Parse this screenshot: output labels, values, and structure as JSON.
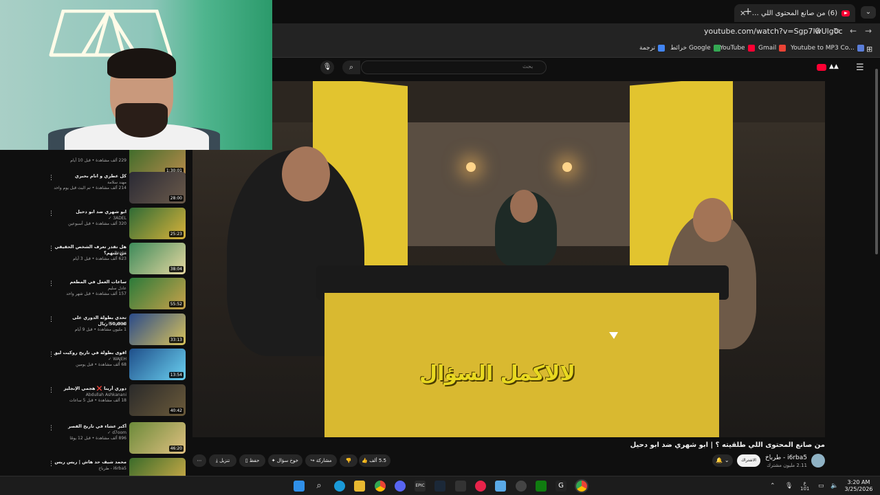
{
  "browser": {
    "tab_title": "(6) من صانع المحتوى اللي ط...",
    "tab_close": "✕",
    "new_tab": "+",
    "url": "youtube.com/watch?v=Sgp7lwUlg0c",
    "bookmarks": [
      {
        "label": "Youtube to MP3 Co...",
        "color": "#5a7dd8"
      },
      {
        "label": "Gmail",
        "color": "#ea4335"
      },
      {
        "label": "YouTube",
        "color": "#ff0033"
      },
      {
        "label": "خرائط Google",
        "color": "#34a853"
      },
      {
        "label": "ترجمة",
        "color": "#4285f4"
      }
    ]
  },
  "youtube": {
    "search_placeholder": "بحث",
    "video": {
      "caption": "لالاكمل السؤال",
      "title": "من صانع المحتوى اللي طلقيته ؟ | ابو شهري ضد ابو دحيل",
      "channel": "i6rba5 - طرباخ",
      "subscribers": "2.11 مليون مشترك",
      "subscribe_label": "الاشتراك",
      "likes": "5.5 ألف",
      "share_label": "مشاركة",
      "ask_label": "خوخ سؤال",
      "save_label": "حفظ",
      "download_label": "تنزيل",
      "more_label": "⋯"
    },
    "recommendations": [
      {
        "title": "",
        "channel": "",
        "meta": "229 ألف مشاهدة • قبل 10 أيام",
        "duration": "1:30:01",
        "colors": [
          "#3a6b2a",
          "#b58a4a"
        ]
      },
      {
        "title": "كل عطري و انام بحبري",
        "channel": "مهند سلامة",
        "meta": "214 ألف مشاهدة • تم البث قبل يوم واحد",
        "duration": "28:00",
        "colors": [
          "#2a2a35",
          "#6b5a4a"
        ]
      },
      {
        "title": "ابو شهري ضد ابو دحيل",
        "channel": "3ADEL ✓",
        "meta": "320 ألف مشاهدة • قبل أسبوعين",
        "duration": "25:23",
        "colors": [
          "#2f6b36",
          "#d9b23a"
        ]
      },
      {
        "title": "هل تقدر تعرف الشخص الحقيقي من بينهم؟",
        "channel": "Peaks ✓",
        "meta": "623 ألف مشاهدة • قبل 3 أيام",
        "duration": "38:04",
        "colors": [
          "#3d8a5a",
          "#e6d7a0"
        ]
      },
      {
        "title": "ساعات العمل في المطعم",
        "channel": "عادل سليم",
        "meta": "157 ألف مشاهدة • قبل شهر واحد",
        "duration": "55:52",
        "colors": [
          "#2b7a3a",
          "#c9a24a"
        ]
      },
      {
        "title": "تحدي بطولة الدوري على 50,000 ريال",
        "channel": "FFearlFul ✓",
        "meta": "1 مليون مشاهدة • قبل 9 أيام",
        "duration": "33:13",
        "colors": [
          "#2a4a8a",
          "#d8c25a"
        ]
      },
      {
        "title": "اقوى بطولة في تاريخ روكيت ليق",
        "channel": "WAJEH ✓",
        "meta": "68 ألف مشاهدة • قبل يومين",
        "duration": "13:54",
        "colors": [
          "#1f4f8a",
          "#6ad0f0"
        ]
      },
      {
        "title": "دوري أرينا ❌ هجمي الإنجليز",
        "channel": "Abdullah Ashkanani",
        "meta": "18 ألف مشاهدة • قبل 5 ساعات",
        "duration": "40:42",
        "colors": [
          "#2a2a2a",
          "#6b5a3a"
        ]
      },
      {
        "title": "أكبر عشاء في تاريخ القصر",
        "channel": "d7oom ✓",
        "meta": "896 ألف مشاهدة • قبل 12 يومًا",
        "duration": "46:20",
        "colors": [
          "#6b8a3a",
          "#e0c080"
        ]
      },
      {
        "title": "محمد شيف حد هاش | ريس ريس",
        "channel": "i6rba5 - طرباخ",
        "meta": "",
        "duration": "",
        "colors": [
          "#3a6b2a",
          "#d8b04a"
        ]
      }
    ]
  },
  "taskbar": {
    "time": "3:20 AM",
    "date": "3/25/2026",
    "lang_top": "ع",
    "lang_bottom": "101"
  },
  "colors": {
    "accent": "#ff0033",
    "banner_yellow": "#e2c42f",
    "caption_yellow": "#e8d820"
  }
}
